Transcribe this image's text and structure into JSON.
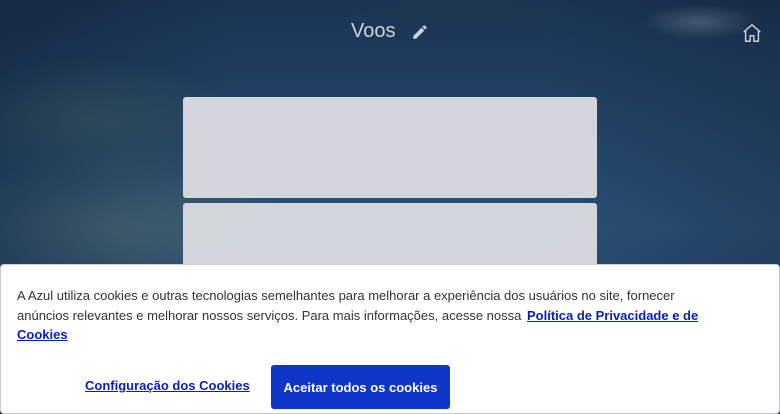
{
  "header": {
    "title": "Voos",
    "edit_icon": "pencil-icon",
    "home_icon": "home-icon"
  },
  "cookie_banner": {
    "text": "A Azul utiliza cookies e outras tecnologias semelhantes para melhorar a experiência dos usuários no site, fornecer anúncios relevantes e melhorar nossos serviços. Para mais informações, acesse nossa",
    "policy_link": "Política de Privacidade e de Cookies",
    "config_label": "Configuração dos Cookies",
    "accept_label": "Aceitar todos os cookies"
  },
  "colors": {
    "accent": "#1036c8",
    "link": "#0a1eb3",
    "card_placeholder": "#d8dbe0"
  }
}
